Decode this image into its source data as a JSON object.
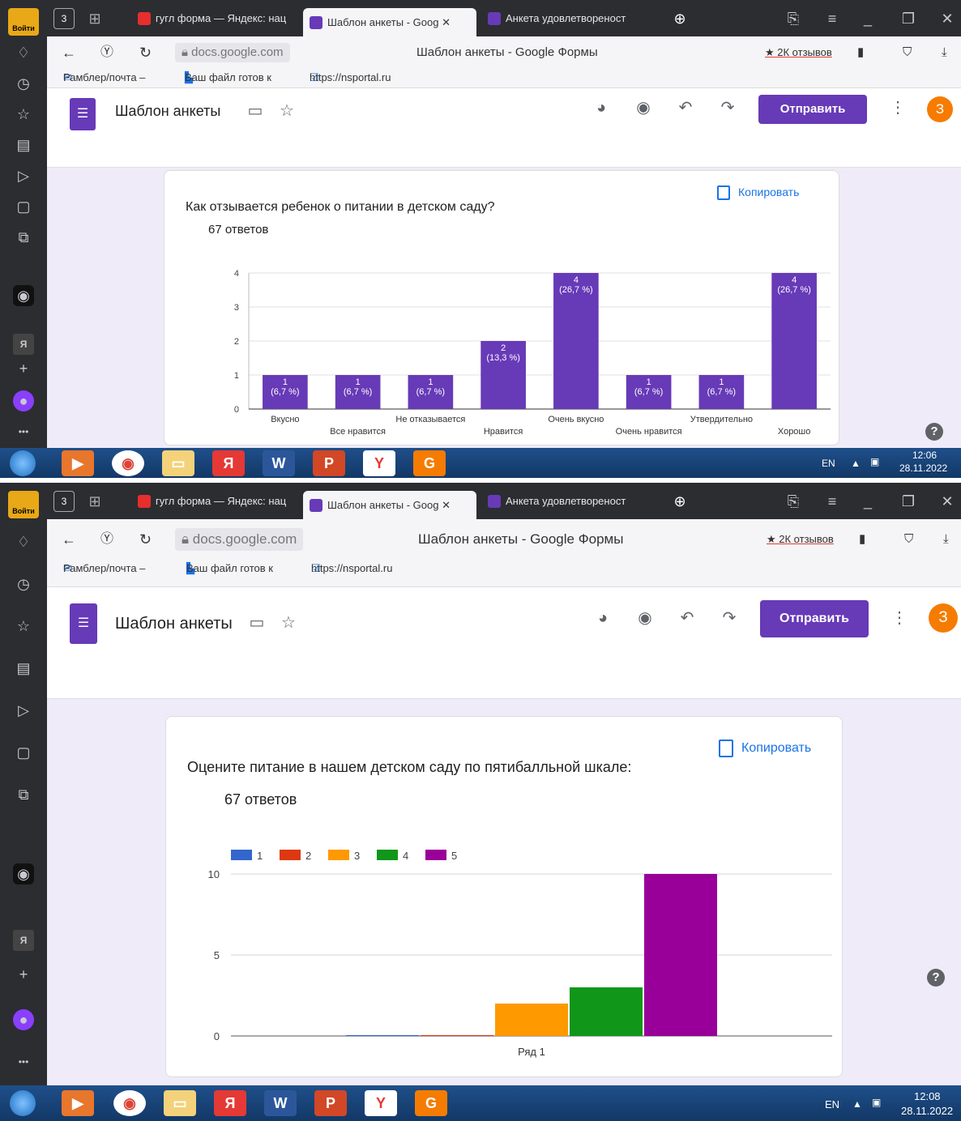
{
  "browser": {
    "login_label": "Войти",
    "tabs": [
      {
        "label": "гугл форма — Яндекс: нац"
      },
      {
        "label": "Шаблон анкеты - Goog"
      },
      {
        "label": "Анкета удовлетвореност"
      }
    ],
    "url_domain": "docs.google.com",
    "page_title": "Шаблон анкеты - Google Формы",
    "reviews": "★ 2К отзывов",
    "bookmarks": [
      "Рамблер/почта –",
      "Ваш файл готов к",
      "https://nsportal.ru"
    ],
    "sidebar_badge": "Я"
  },
  "form": {
    "title": "Шаблон анкеты",
    "send_label": "Отправить",
    "avatar_letter": "З"
  },
  "copy_label": "Копировать",
  "taskbar": [
    {
      "lang": "EN",
      "time": "12:06",
      "date": "28.11.2022"
    },
    {
      "lang": "EN",
      "time": "12:08",
      "date": "28.11.2022"
    }
  ],
  "questions": [
    {
      "text": "Как отзывается ребенок о питании в детском саду?",
      "count": "67 ответов"
    },
    {
      "text": "Оцените питание в нашем детском саду по пятибалльной шкале:",
      "count": "67 ответов"
    }
  ],
  "chart_data": [
    {
      "type": "bar",
      "categories": [
        "Вкусно",
        "Все нравится",
        "Не отказывается",
        "Нравится",
        "Очень вкусно",
        "Очень нравится",
        "Утвердительно",
        "Хорошо"
      ],
      "values": [
        1,
        1,
        1,
        2,
        4,
        1,
        1,
        4
      ],
      "data_labels": [
        "(6,7 %)",
        "(6,7 %)",
        "(6,7 %)",
        "(13,3 %)",
        "(26,7 %)",
        "(6,7 %)",
        "(6,7 %)",
        "(26,7 %)"
      ],
      "yticks": [
        "0",
        "1",
        "2",
        "3",
        "4"
      ],
      "ylim": [
        0,
        4
      ],
      "color": "#673ab7"
    },
    {
      "type": "bar",
      "categories": [
        "Ряд 1"
      ],
      "series": [
        {
          "name": "1",
          "values": [
            0
          ],
          "color": "#3366cc"
        },
        {
          "name": "2",
          "values": [
            0
          ],
          "color": "#dc3912"
        },
        {
          "name": "3",
          "values": [
            2
          ],
          "color": "#ff9900"
        },
        {
          "name": "4",
          "values": [
            3
          ],
          "color": "#109618"
        },
        {
          "name": "5",
          "values": [
            10
          ],
          "color": "#990099"
        }
      ],
      "yticks": [
        "0",
        "5",
        "10"
      ],
      "ylim": [
        0,
        10
      ],
      "legend": "top-left"
    }
  ]
}
